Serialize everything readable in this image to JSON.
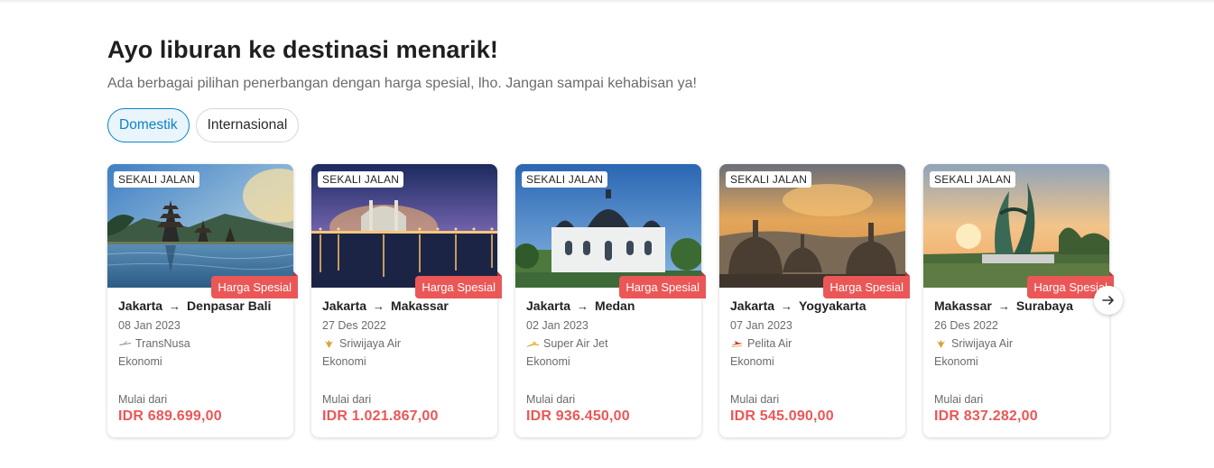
{
  "header": {
    "title": "Ayo liburan ke destinasi menarik!",
    "subtitle": "Ada berbagai pilihan penerbangan dengan harga spesial, lho. Jangan sampai kehabisan ya!"
  },
  "tabs": [
    {
      "label": "Domestik",
      "active": true
    },
    {
      "label": "Internasional",
      "active": false
    }
  ],
  "colors": {
    "accent": "#0a84c6",
    "price": "#eb5757",
    "promo": "#eb5757"
  },
  "cards": [
    {
      "trip_type": "SEKALI JALAN",
      "promo": "Harga Spesial",
      "origin": "Jakarta",
      "destination": "Denpasar Bali",
      "date": "08 Jan 2023",
      "airline": "TransNusa",
      "airline_icon": "transnusa-logo",
      "cabin": "Ekonomi",
      "price_label": "Mulai dari",
      "price": "IDR 689.699,00",
      "image": "bali-temple-lake"
    },
    {
      "trip_type": "SEKALI JALAN",
      "promo": "Harga Spesial",
      "origin": "Jakarta",
      "destination": "Makassar",
      "date": "27 Des 2022",
      "airline": "Sriwijaya Air",
      "airline_icon": "sriwijaya-logo",
      "cabin": "Ekonomi",
      "price_label": "Mulai dari",
      "price": "IDR 1.021.867,00",
      "image": "floating-mosque-night"
    },
    {
      "trip_type": "SEKALI JALAN",
      "promo": "Harga Spesial",
      "origin": "Jakarta",
      "destination": "Medan",
      "date": "02 Jan 2023",
      "airline": "Super Air Jet",
      "airline_icon": "superairjet-logo",
      "cabin": "Ekonomi",
      "price_label": "Mulai dari",
      "price": "IDR 936.450,00",
      "image": "grand-mosque-medan"
    },
    {
      "trip_type": "SEKALI JALAN",
      "promo": "Harga Spesial",
      "origin": "Jakarta",
      "destination": "Yogyakarta",
      "date": "07 Jan 2023",
      "airline": "Pelita Air",
      "airline_icon": "pelita-logo",
      "cabin": "Ekonomi",
      "price_label": "Mulai dari",
      "price": "IDR 545.090,00",
      "image": "borobudur-stupas"
    },
    {
      "trip_type": "SEKALI JALAN",
      "promo": "Harga Spesial",
      "origin": "Makassar",
      "destination": "Surabaya",
      "date": "26 Des 2022",
      "airline": "Sriwijaya Air",
      "airline_icon": "sriwijaya-logo",
      "cabin": "Ekonomi",
      "price_label": "Mulai dari",
      "price": "IDR 837.282,00",
      "image": "suro-boyo-monument"
    }
  ],
  "carousel": {
    "next_icon": "arrow-right-icon"
  }
}
